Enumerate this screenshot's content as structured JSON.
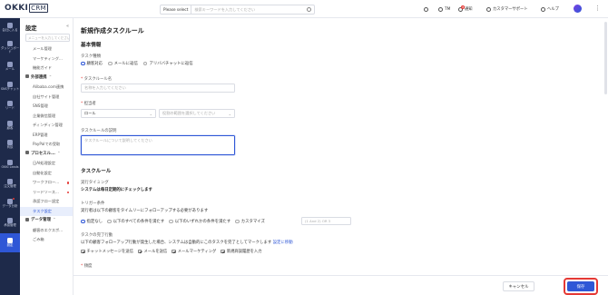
{
  "header": {
    "logo_main": "OKKI",
    "logo_suffix": "CRM",
    "search_scope": "Please select",
    "search_placeholder": "検索キーワードを入力してください",
    "tm_label": "TM",
    "notify_label": "通知",
    "notify_badge": "8",
    "support_label": "カスタマーサポート",
    "help_label": "ヘルプ"
  },
  "rail": [
    {
      "label": "会社に入る",
      "active": false
    },
    {
      "label": "ダッシュボード",
      "active": false
    },
    {
      "label": "メール",
      "active": false
    },
    {
      "label": "SNSチャット",
      "active": false
    },
    {
      "label": "リード",
      "active": false
    },
    {
      "label": "顧客",
      "active": false
    },
    {
      "label": "商談",
      "active": false
    },
    {
      "label": "OKKI Leads",
      "active": false
    },
    {
      "label": "注文管理",
      "active": false
    },
    {
      "label": "データ分析",
      "active": false,
      "dot": true
    },
    {
      "label": "承認管理",
      "active": false
    },
    {
      "label": "設定",
      "active": true
    }
  ],
  "submenu": {
    "title": "設定",
    "collapse": "«",
    "search_placeholder": "メニューを入力してください",
    "items": [
      {
        "kind": "item",
        "label": "メール管理"
      },
      {
        "kind": "item",
        "label": "マーケティング..."
      },
      {
        "kind": "item",
        "label": "機能ガイド"
      },
      {
        "kind": "group",
        "label": "外部連携"
      },
      {
        "kind": "item",
        "label": "Alibaba.com連携"
      },
      {
        "kind": "item",
        "label": "自社サイト管理"
      },
      {
        "kind": "item",
        "label": "SNS管理"
      },
      {
        "kind": "item",
        "label": "企業微信管理"
      },
      {
        "kind": "item",
        "label": "ディンディン管理"
      },
      {
        "kind": "item",
        "label": "ERP管理"
      },
      {
        "kind": "item",
        "label": "PayPalでの受取"
      },
      {
        "kind": "group",
        "label": "プロセスル..."
      },
      {
        "kind": "item",
        "label": "日AI処理設定"
      },
      {
        "kind": "item",
        "label": "自動化設定"
      },
      {
        "kind": "item",
        "label": "ワークフロー...",
        "dot": true
      },
      {
        "kind": "item",
        "label": "リードソース...",
        "dot": true
      },
      {
        "kind": "item",
        "label": "承認フロー設定"
      },
      {
        "kind": "item",
        "label": "タスク設定",
        "active": true
      },
      {
        "kind": "group",
        "label": "データ管理"
      },
      {
        "kind": "item",
        "label": "顧客のエクスポ..."
      },
      {
        "kind": "item",
        "label": "ごみ箱"
      }
    ]
  },
  "form": {
    "page_title": "新規作成タスクルール",
    "basic_info": "基本情報",
    "task_type_label": "タスク種類",
    "task_types": [
      "顧客対応",
      "メールに返信",
      "アリババチャットに返信"
    ],
    "rule_name_label": "タスクルール名",
    "rule_name_placeholder": "名称を入力してください",
    "assignee_label": "担当者",
    "assignee_value": "ロール",
    "assignee_placeholder": "役割の範囲を選択してください",
    "desc_label": "タスクルールの説明",
    "desc_placeholder": "タスクルールについて説明してください",
    "task_rule": "タスクルール",
    "timing_label": "実行タイミング",
    "timing_text": "システムは毎日定期的にチェックします",
    "trigger_label": "トリガー条件",
    "trigger_text": "実行者は以下の顧客をタイムリーにフォローアップする必要があります",
    "trigger_options": [
      "指定なし",
      "以下のすべての条件を満たす",
      "以下のいずれかの条件を満たす",
      "カスタマイズ"
    ],
    "trigger_custom_placeholder": "(1 And 2) OR 3",
    "completion_label": "タスクの完了行動",
    "completion_text": "以下の顧客フォローアップ行動が発生した場合、システムは自動的にこのタスクを完了としてマークします",
    "completion_link": "設定に移動",
    "completion_checks": [
      "チャットメッセージを送信",
      "メールを送信",
      "メールマーケティング",
      "新規商談履歴を入力"
    ],
    "frequency_label": "頻度",
    "cancel_label": "キャンセル",
    "save_label": "保存"
  }
}
